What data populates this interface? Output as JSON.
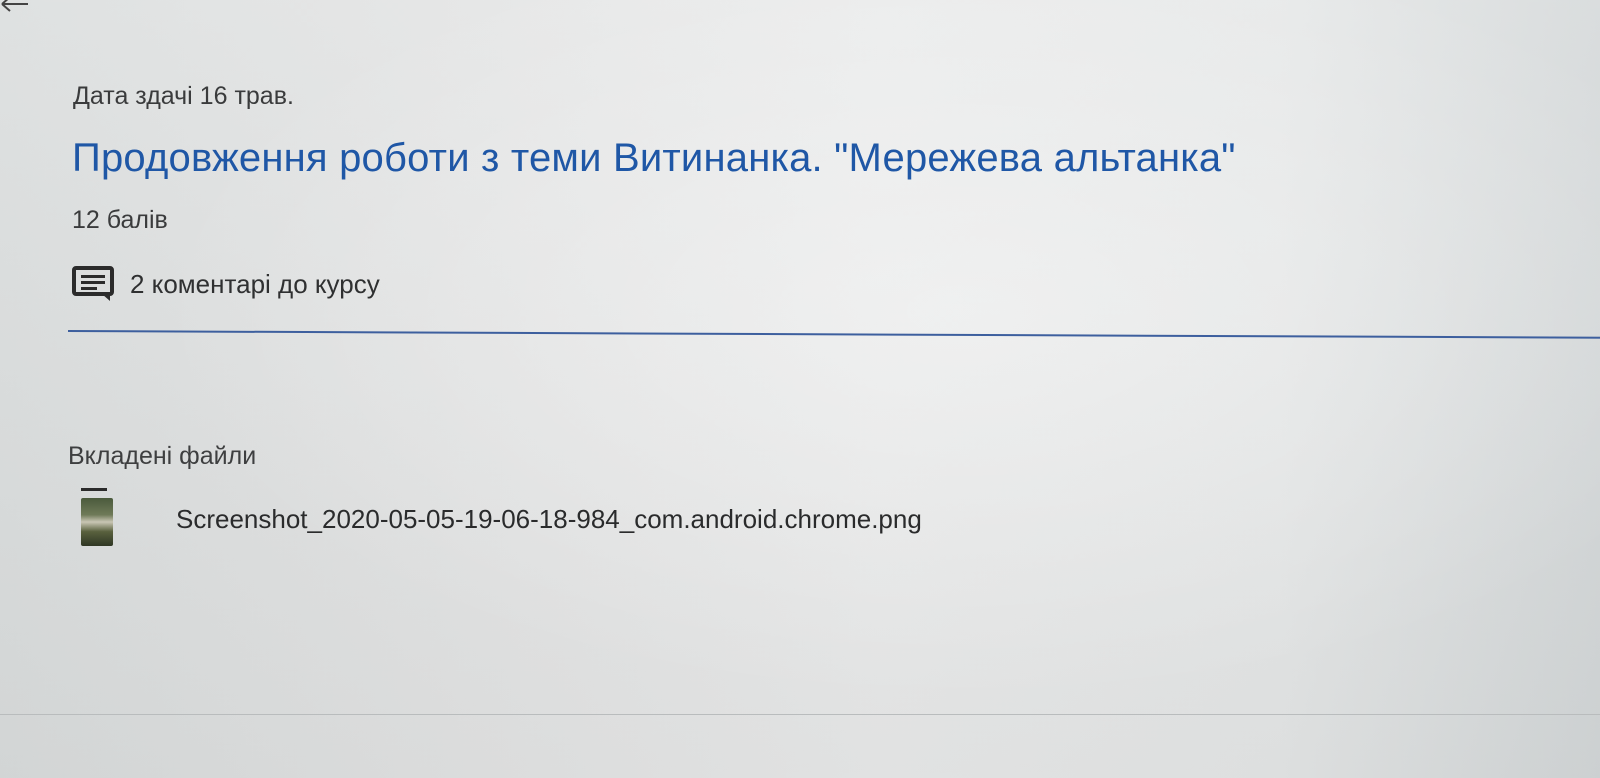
{
  "assignment": {
    "due_date": "Дата здачі 16 трав.",
    "title": "Продовження роботи з теми Витинанка. \"Мережева альтанка\"",
    "points": "12 балів",
    "comments_label": "2 коментарі до курсу"
  },
  "attachments": {
    "heading": "Вкладені файли",
    "files": [
      {
        "name": "Screenshot_2020-05-05-19-06-18-984_com.android.chrome.png"
      }
    ]
  },
  "colors": {
    "title": "#1f57a6",
    "divider": "#3d5f9e",
    "text": "#3a3b3c"
  },
  "icons": {
    "back": "arrow-left-icon",
    "comments": "comment-icon",
    "file_thumbnail": "image-thumbnail-icon"
  }
}
